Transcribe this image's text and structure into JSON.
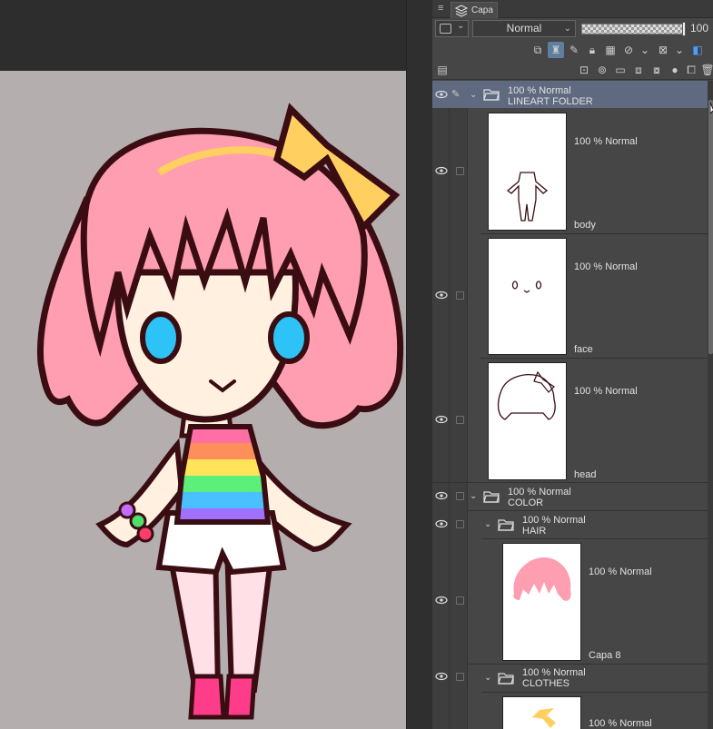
{
  "panel": {
    "menu_glyph": "≡",
    "tab_label": "Capa",
    "blend_mode": "Normal",
    "opacity_value": "100",
    "icons": {
      "tab": "layers-icon",
      "dropdown": "chevron-down-icon",
      "eye": "eye-icon",
      "folder": "folder-icon",
      "pen": "pen-icon"
    }
  },
  "layers": [
    {
      "kind": "folder",
      "opacity": "100 %",
      "mode": "Normal",
      "name": "LINEART FOLDER",
      "selected": true
    },
    {
      "kind": "layer",
      "info": "100 % Normal",
      "name": "body"
    },
    {
      "kind": "layer",
      "info": "100 % Normal",
      "name": "face"
    },
    {
      "kind": "layer",
      "info": "100 % Normal",
      "name": "head"
    },
    {
      "kind": "folder",
      "opacity": "100 % Normal",
      "name": "COLOR"
    },
    {
      "kind": "folder",
      "opacity": "100 % Normal",
      "name": "HAIR"
    },
    {
      "kind": "layer",
      "info": "100 % Normal",
      "name": "Capa 8"
    },
    {
      "kind": "folder",
      "opacity": "100 % Normal",
      "name": "CLOTHES"
    },
    {
      "kind": "layer",
      "info": "100 % Normal",
      "name": ""
    }
  ],
  "colors": {
    "canvas_bg": "#b5aeaf",
    "hair": "#ff9eb0",
    "skin": "#fff0e0",
    "outline": "#3a0d12",
    "bow": "#ffd060",
    "eyes": "#2ec3f7",
    "selection": "#5f6a80"
  }
}
